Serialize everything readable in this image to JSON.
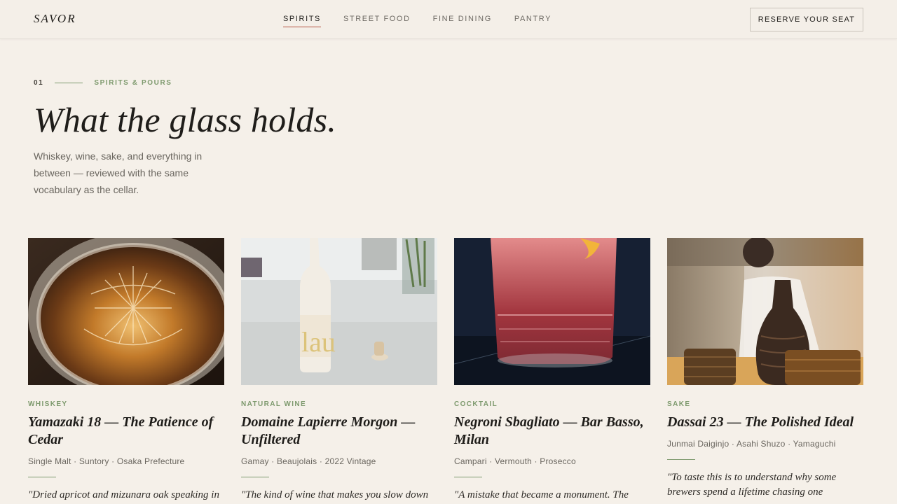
{
  "brand": "SAVOR",
  "nav": [
    {
      "label": "SPIRITS",
      "active": true
    },
    {
      "label": "STREET FOOD",
      "active": false
    },
    {
      "label": "FINE DINING",
      "active": false
    },
    {
      "label": "PANTRY",
      "active": false
    }
  ],
  "cta": "RESERVE YOUR SEAT",
  "hero": {
    "number": "01",
    "kicker": "SPIRITS & POURS",
    "title": "What the glass holds.",
    "lede": "Whiskey, wine, sake, and everything in between — reviewed with the same vocabulary as the cellar."
  },
  "colors": {
    "accent_green": "#7e9a6e",
    "accent_red": "#b5523f",
    "background": "#f5f0e9"
  },
  "cards": [
    {
      "category": "WHISKEY",
      "title": "Yamazaki 18 — The Patience of Cedar",
      "meta": "Single Malt · Suntory · Osaka Prefecture",
      "quote": "\"Dried apricot and mizunara oak speaking in",
      "image": "whiskey-glass-photo"
    },
    {
      "category": "NATURAL WINE",
      "title": "Domaine Lapierre Morgon — Unfiltered",
      "meta": "Gamay · Beaujolais · 2022 Vintage",
      "quote": "\"The kind of wine that makes you slow down",
      "image": "wine-bottle-photo",
      "label_text": "lau"
    },
    {
      "category": "COCKTAIL",
      "title": "Negroni Sbagliato — Bar Basso, Milan",
      "meta": "Campari · Vermouth · Prosecco",
      "quote": "\"A mistake that became a monument. The",
      "image": "cocktail-glass-photo"
    },
    {
      "category": "SAKE",
      "title": "Dassai 23 — The Polished Ideal",
      "meta": "Junmai Daiginjo · Asahi Shuzo · Yamaguchi",
      "quote": "\"To taste this is to understand why some brewers spend a lifetime chasing one",
      "image": "sake-vessels-photo"
    }
  ]
}
